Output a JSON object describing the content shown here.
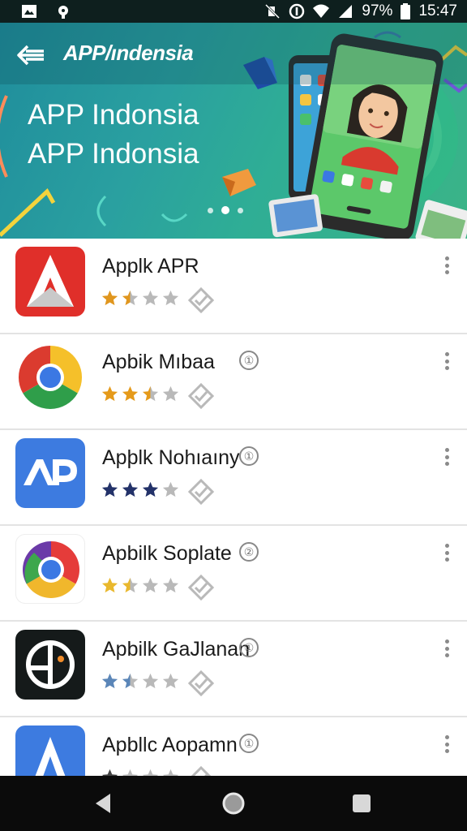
{
  "status_bar": {
    "battery": "97%",
    "time": "15:47",
    "icons": [
      "image-icon",
      "notification-icon",
      "mute-icon",
      "data-saver-icon",
      "wifi-icon",
      "signal-icon",
      "battery-icon"
    ]
  },
  "header": {
    "title": "APP/ındensia",
    "back_icon": "back-arrow-icon"
  },
  "banner": {
    "headline_1": "APP Indonsia",
    "headline_2": "APP Indonsia",
    "slides": 3,
    "active_slide": 2
  },
  "apps": [
    {
      "name": "Applk APR",
      "badge": "",
      "rating": 1.5,
      "star_color": "#e0961e",
      "icon": "red-a-logo-icon"
    },
    {
      "name": "Apbik Mıbaa",
      "badge": "①",
      "rating": 2.5,
      "star_color": "#e59a1a",
      "icon": "chrome-logo-icon"
    },
    {
      "name": "Apþlk Nohıaıny",
      "badge": "①",
      "rating": 3,
      "star_color": "#233269",
      "icon": "blue-ap-logo-icon"
    },
    {
      "name": "Apbilk Soplate",
      "badge": "②",
      "rating": 1.5,
      "star_color": "#e9b82d",
      "icon": "chrome-variant-logo-icon"
    },
    {
      "name": "Apbilk GaJlanan",
      "badge": "①",
      "rating": 1.5,
      "star_color": "#5b86b8",
      "icon": "dark-circle-logo-icon"
    },
    {
      "name": "Apbllc Aopamn",
      "badge": "①",
      "rating": 1,
      "star_color": "#444444",
      "icon": "blue-a-logo-icon"
    }
  ],
  "nav_bar": {
    "back": "back-triangle-icon",
    "home": "home-circle-icon",
    "recents": "recents-square-icon"
  },
  "colors": {
    "banner_gradient_start": "#1f8d9c",
    "banner_gradient_end": "#3bb487",
    "status_bar": "#0e1f1e",
    "nav_bar": "#0b0b0b",
    "divider": "#e3e3e3"
  }
}
